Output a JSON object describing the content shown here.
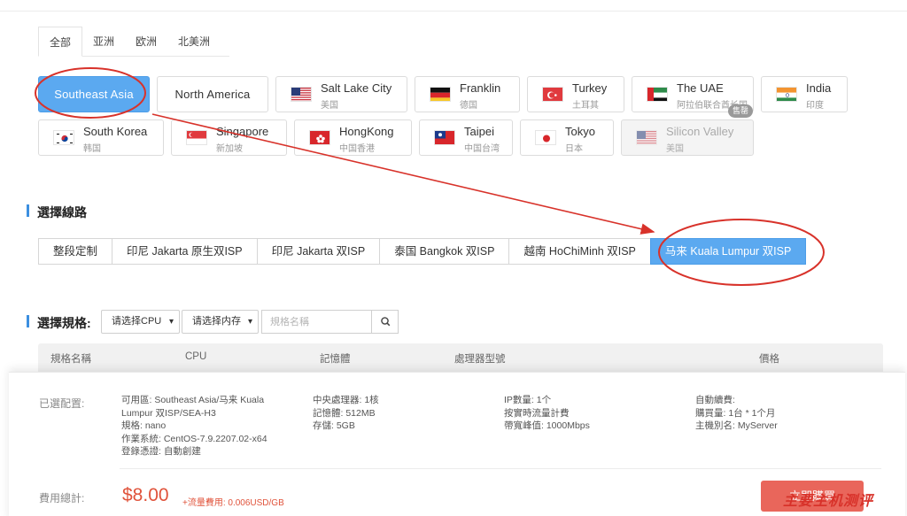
{
  "region_tabs": [
    "全部",
    "亚洲",
    "欧洲",
    "北美洲"
  ],
  "locations": {
    "southeast_asia": "Southeast Asia",
    "north_america": "North America",
    "salt_lake": {
      "name": "Salt Lake City",
      "sub": "美国",
      "flag": "us-flag-icon"
    },
    "franklin": {
      "name": "Franklin",
      "sub": "德国",
      "flag": "germany-flag-icon"
    },
    "turkey": {
      "name": "Turkey",
      "sub": "土耳其",
      "flag": "turkey-flag-icon"
    },
    "uae": {
      "name": "The UAE",
      "sub": "阿拉伯联合酋长国",
      "flag": "uae-flag-icon",
      "badge": "售罄"
    },
    "india": {
      "name": "India",
      "sub": "印度",
      "flag": "india-flag-icon"
    },
    "south_korea": {
      "name": "South Korea",
      "sub": "韩国",
      "flag": "korea-flag-icon"
    },
    "singapore": {
      "name": "Singapore",
      "sub": "新加坡",
      "flag": "singapore-flag-icon"
    },
    "hongkong": {
      "name": "HongKong",
      "sub": "中国香港",
      "flag": "hongkong-flag-icon"
    },
    "taipei": {
      "name": "Taipei",
      "sub": "中国台湾",
      "flag": "taiwan-flag-icon"
    },
    "tokyo": {
      "name": "Tokyo",
      "sub": "日本",
      "flag": "japan-flag-icon"
    },
    "silicon_valley": {
      "name": "Silicon Valley",
      "sub": "美国",
      "flag": "us-flag-icon"
    }
  },
  "route_section": {
    "title": "選擇線路"
  },
  "routes": [
    "整段定制",
    "印尼 Jakarta 原生双ISP",
    "印尼 Jakarta 双ISP",
    "泰国 Bangkok 双ISP",
    "越南 HoChiMinh 双ISP",
    "马来 Kuala Lumpur 双ISP"
  ],
  "spec_section": {
    "title": "選擇規格:",
    "cpu_select": "请选择CPU",
    "mem_select": "请选择内存",
    "search_placeholder": "規格名稱"
  },
  "table_headers": [
    "規格名稱",
    "CPU",
    "記憶體",
    "處理器型號",
    "價格"
  ],
  "summary": {
    "selected_label": "已選配置:",
    "col1": [
      "可用區: Southeast Asia/马来 Kuala",
      "Lumpur 双ISP/SEA-H3",
      "規格: nano",
      "作業系統: CentOS-7.9.2207.02-x64",
      "登錄憑證: 自動創建"
    ],
    "col2": [
      "中央處理器: 1核",
      "記憶體: 512MB",
      "存儲: 5GB"
    ],
    "col3": [
      "IP數量: 1个",
      "按實時流量計費",
      "帶寬峰值: 1000Mbps"
    ],
    "col4": [
      "自動續費:",
      "購買量: 1台 * 1个月",
      "主機別名: MyServer"
    ],
    "fee_label": "費用總計:",
    "price": "$8.00",
    "traffic_fee": "+流量費用: 0.006USD/GB",
    "buy_button": "立即購買"
  },
  "watermark": "主要主机测评",
  "colors": {
    "accent_blue": "#5ba9f0",
    "annotation_red": "#d8322a",
    "buy_red": "#e9665b"
  }
}
